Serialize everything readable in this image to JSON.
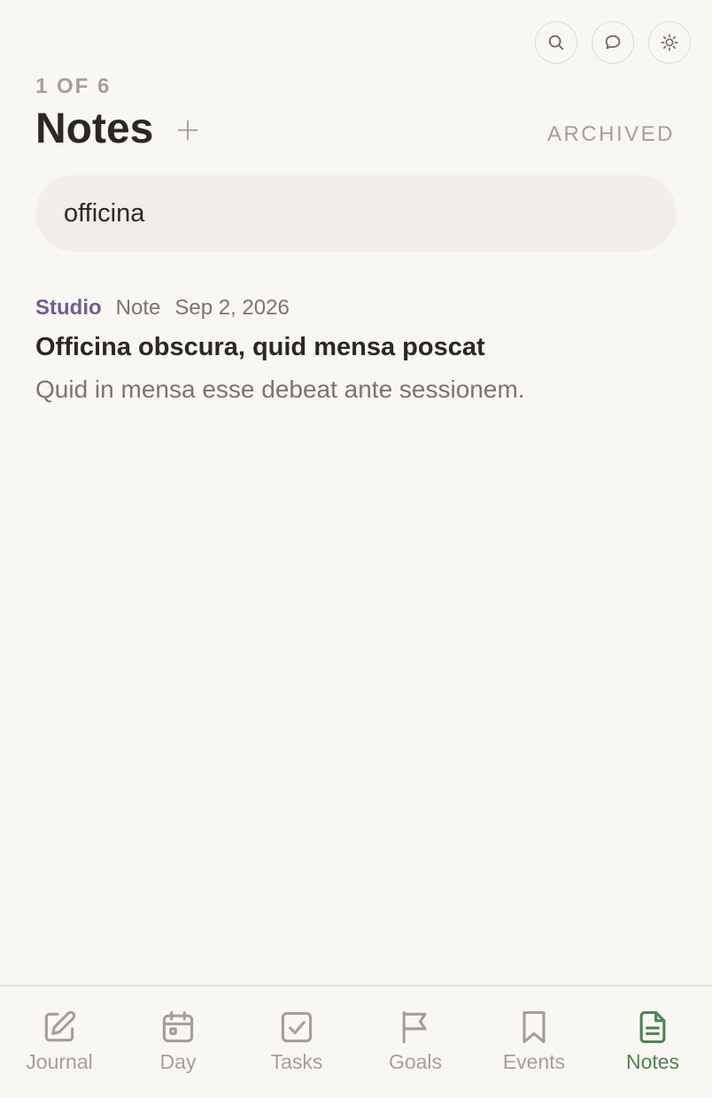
{
  "header": {
    "counter": "1 OF 6",
    "title": "Notes",
    "archived_label": "ARCHIVED"
  },
  "top_actions": {
    "icons": [
      "search-icon",
      "chat-bubble-icon",
      "sun-icon"
    ]
  },
  "search": {
    "value": "officina",
    "placeholder": ""
  },
  "notes": [
    {
      "project": "Studio",
      "type": "Note",
      "date": "Sep 2, 2026",
      "title": "Officina obscura, quid mensa poscat",
      "excerpt": "Quid in mensa esse debeat ante sessionem."
    }
  ],
  "tabbar": {
    "tabs": [
      {
        "label": "Journal",
        "icon": "pencil-square-icon"
      },
      {
        "label": "Day",
        "icon": "calendar-icon"
      },
      {
        "label": "Tasks",
        "icon": "checkbox-icon"
      },
      {
        "label": "Goals",
        "icon": "flag-icon"
      },
      {
        "label": "Events",
        "icon": "bookmark-icon"
      },
      {
        "label": "Notes",
        "icon": "document-icon"
      }
    ],
    "active": "Notes"
  },
  "colors": {
    "background": "#f9f7f3",
    "accent_green": "#4e8450",
    "project_purple": "#6d5e92",
    "muted": "#a59f96"
  }
}
